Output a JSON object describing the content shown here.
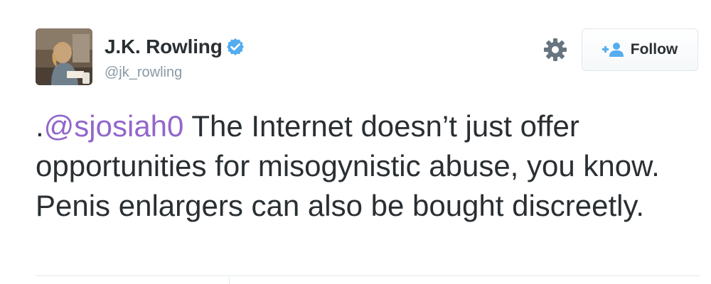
{
  "user": {
    "display_name": "J.K. Rowling",
    "handle": "@jk_rowling",
    "verified_icon": "verified-badge-icon"
  },
  "actions": {
    "settings_icon": "gear-icon",
    "follow_label": "Follow",
    "follow_icon": "add-user-icon"
  },
  "tweet": {
    "prefix": ".",
    "mention": "@sjosiah0",
    "body": " The Internet doesn’t just offer opportunities for misogynistic abuse, you know. Penis enlargers can also be bought discreetly."
  },
  "colors": {
    "mention": "#9266cc",
    "verified": "#55acee",
    "text": "#292f33",
    "muted": "#8899a6"
  }
}
